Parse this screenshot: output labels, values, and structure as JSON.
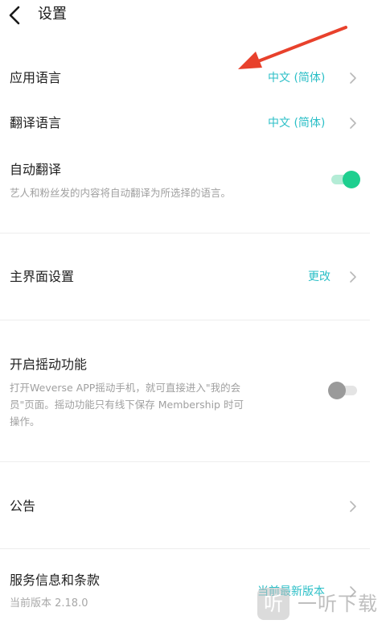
{
  "header": {
    "title": "设置",
    "back_icon": "chevron-left-icon"
  },
  "settings": {
    "app_language": {
      "label": "应用语言",
      "value": "中文 (简体)"
    },
    "translate_language": {
      "label": "翻译语言",
      "value": "中文 (简体)"
    },
    "auto_translate": {
      "label": "自动翻译",
      "description": "艺人和粉丝发的内容将自动翻译为所选择的语言。",
      "enabled": true
    },
    "main_interface": {
      "label": "主界面设置",
      "value": "更改"
    },
    "shake": {
      "label": "开启摇动功能",
      "description_line1": "打开Weverse APP摇动手机，就可直接进入\"我的会",
      "description_line2": "员\"页面。摇动功能只有线下保存 Membership 时可",
      "description_line3": "操作。",
      "enabled": false
    },
    "notice": {
      "label": "公告"
    },
    "service": {
      "label": "服务信息和条款",
      "sub": "当前版本 2.18.0",
      "value": "当前最新版本"
    }
  },
  "watermark": {
    "glyph": "听",
    "text": "一听下载"
  },
  "colors": {
    "accent": "#2bbfc7",
    "toggle_on": "#1ecf8f",
    "toggle_off_knob": "#9a9a9a",
    "annotation_arrow": "#e8412c"
  }
}
